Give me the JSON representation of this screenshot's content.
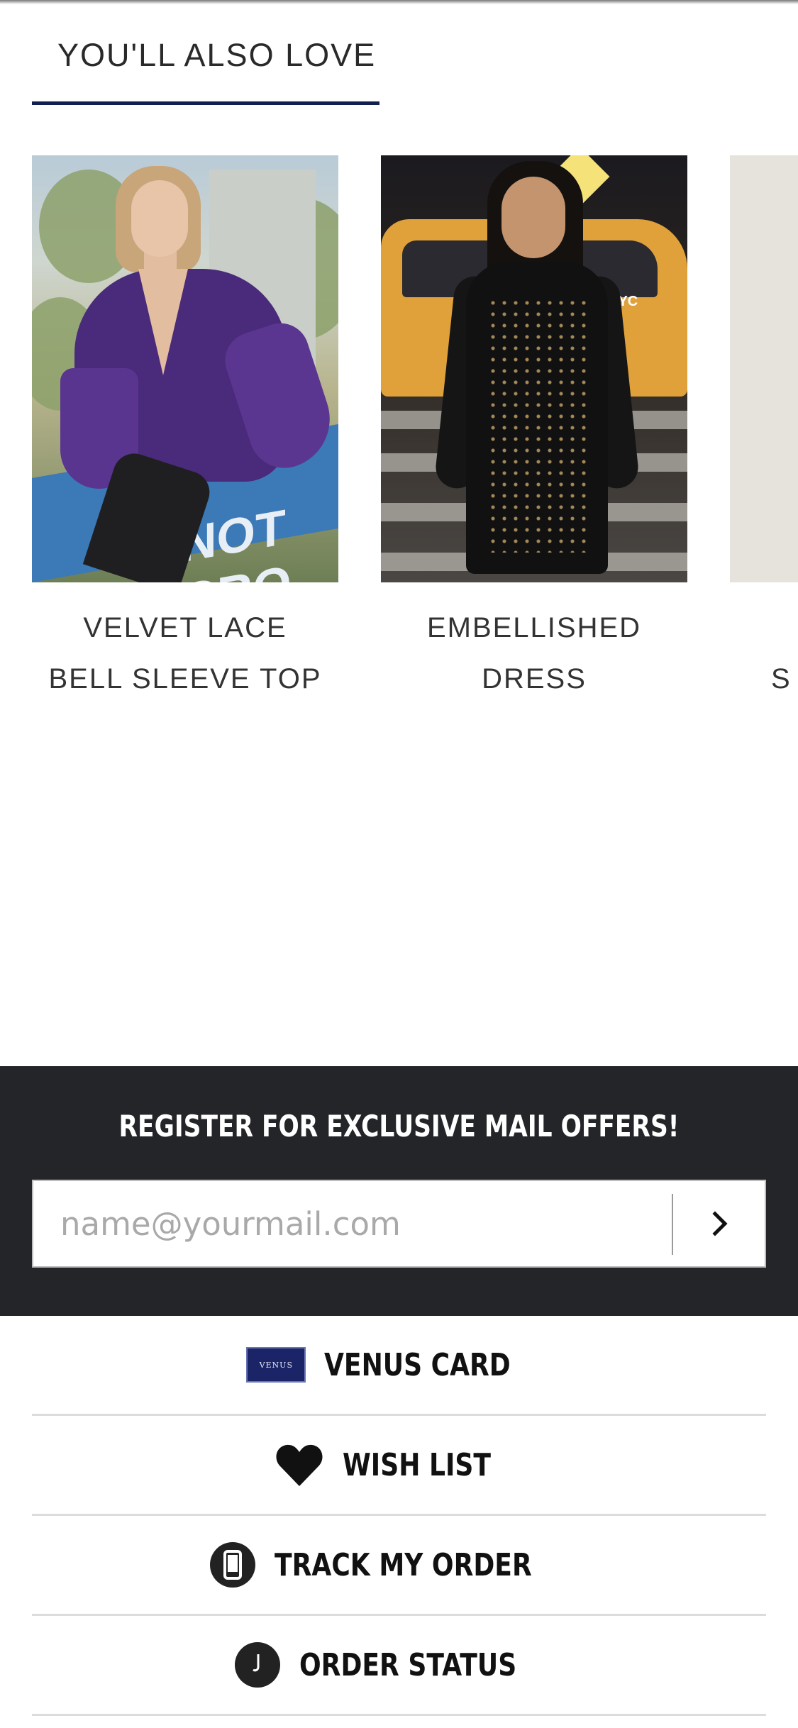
{
  "section": {
    "title": "YOU'LL ALSO LOVE"
  },
  "products": [
    {
      "name": "VELVET LACE BELL SLEEVE TOP",
      "image": "purple-lace-top-photo",
      "sign_text": "NOT CRO"
    },
    {
      "name": "EMBELLISHED DRESS",
      "image": "black-embellished-dress-photo",
      "sign_text": "NYC"
    },
    {
      "name": "S",
      "image": "partial-product-photo"
    }
  ],
  "newsletter": {
    "title": "REGISTER FOR EXCLUSIVE MAIL OFFERS!",
    "placeholder": "name@yourmail.com",
    "submit_icon": "chevron-right-icon"
  },
  "footer_links": [
    {
      "label": "VENUS CARD",
      "icon": "venus-card-icon",
      "icon_text": "VENUS"
    },
    {
      "label": "WISH LIST",
      "icon": "heart-icon"
    },
    {
      "label": "TRACK MY ORDER",
      "icon": "phone-icon"
    },
    {
      "label": "ORDER STATUS",
      "icon": "clock-icon"
    }
  ],
  "colors": {
    "accent_underline": "#13204f",
    "register_band": "#232528",
    "divider": "#dcdcdc"
  }
}
